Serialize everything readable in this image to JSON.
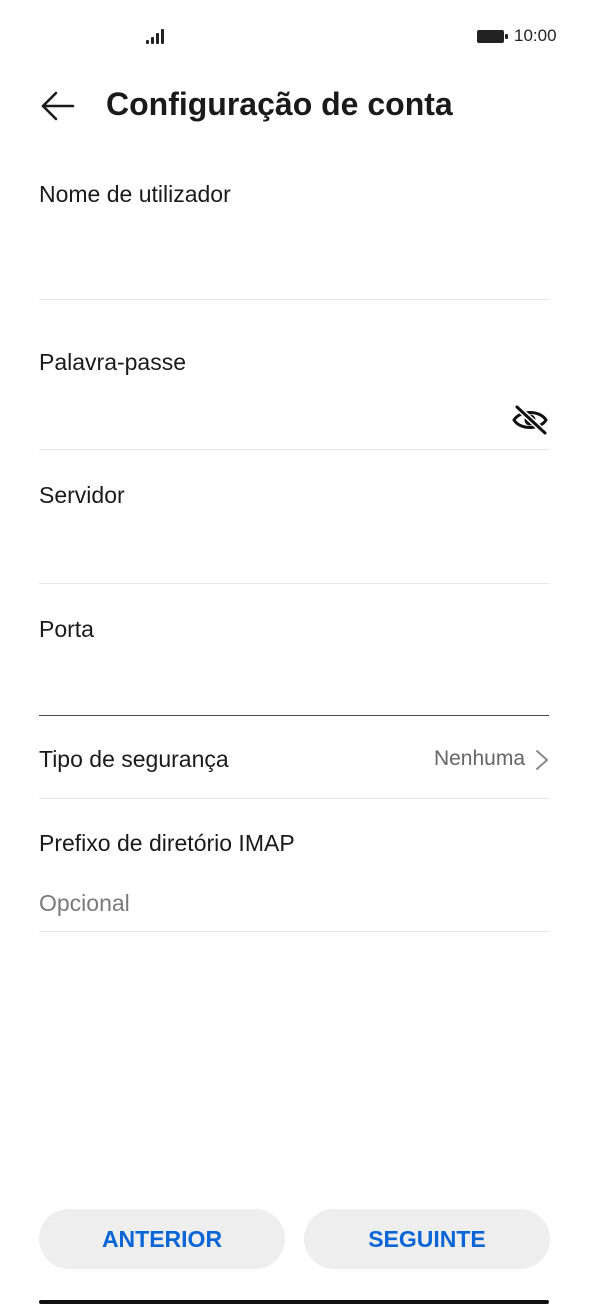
{
  "status_bar": {
    "time": "10:00"
  },
  "header": {
    "title": "Configuração de conta"
  },
  "form": {
    "username": {
      "label": "Nome de utilizador",
      "value": ""
    },
    "password": {
      "label": "Palavra-passe",
      "value": ""
    },
    "server": {
      "label": "Servidor",
      "value": ""
    },
    "port": {
      "label": "Porta",
      "value": ""
    },
    "security": {
      "label": "Tipo de segurança",
      "value": "Nenhuma"
    },
    "imap_prefix": {
      "label": "Prefixo de diretório IMAP",
      "placeholder": "Opcional",
      "value": ""
    }
  },
  "buttons": {
    "previous": "ANTERIOR",
    "next": "SEGUINTE"
  },
  "colors": {
    "accent": "#0a66d6",
    "button_bg": "#eeeeee",
    "divider": "#e6e6e6"
  }
}
